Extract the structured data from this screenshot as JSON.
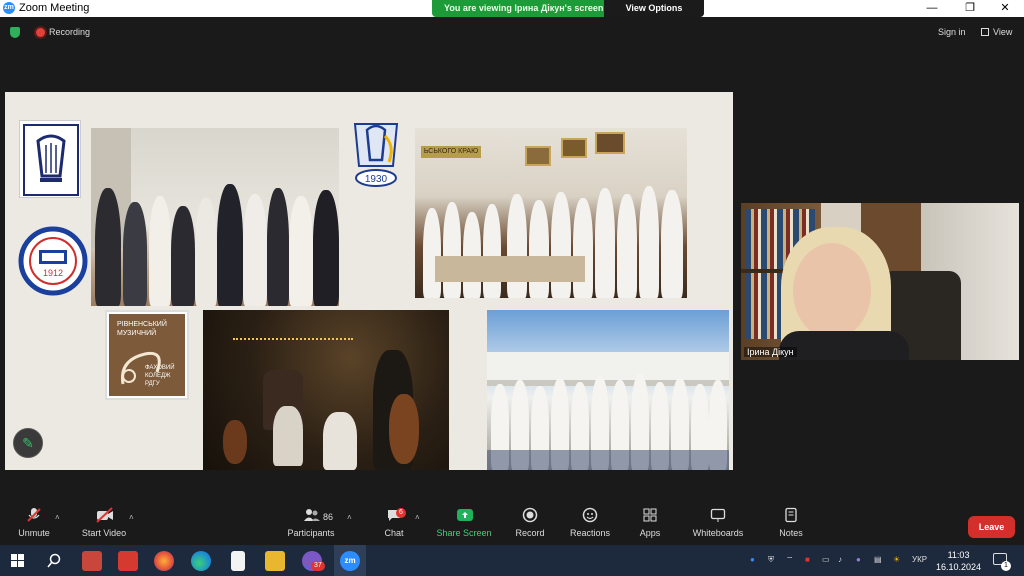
{
  "window": {
    "title": "Zoom Meeting",
    "app_badge": "zm",
    "minimize": "—",
    "maximize": "❐",
    "close": "✕"
  },
  "banner": {
    "message": "You are viewing Ірина Дікун's screen",
    "options": "View Options"
  },
  "meeting": {
    "recording": "Recording",
    "sign_in": "Sign in",
    "view": "View"
  },
  "share": {
    "logo_years": [
      "1912",
      "1930"
    ],
    "college_logo_lines": [
      "РІВНЕНСЬКИЙ",
      "МУЗИЧНИЙ",
      "ФАХОВИЙ",
      "КОЛЕДЖ",
      "РДГУ"
    ],
    "board_text": "ЬСЬКОГО КРАЮ"
  },
  "participant": {
    "name": "Ірина Дікун"
  },
  "toolbar": {
    "unmute": "Unmute",
    "start_video": "Start Video",
    "participants": "Participants",
    "participants_count": "86",
    "chat": "Chat",
    "chat_badge": "6",
    "share_screen": "Share Screen",
    "record": "Record",
    "reactions": "Reactions",
    "apps": "Apps",
    "whiteboards": "Whiteboards",
    "notes": "Notes",
    "leave": "Leave"
  },
  "taskbar": {
    "viber_badge": "37",
    "language": "УКР",
    "time": "11:03",
    "date": "16.10.2024",
    "notification_count": "1"
  },
  "colors": {
    "accent_green": "#1e9b39",
    "leave_red": "#d4302b",
    "zoom_blue": "#2d8cff"
  }
}
